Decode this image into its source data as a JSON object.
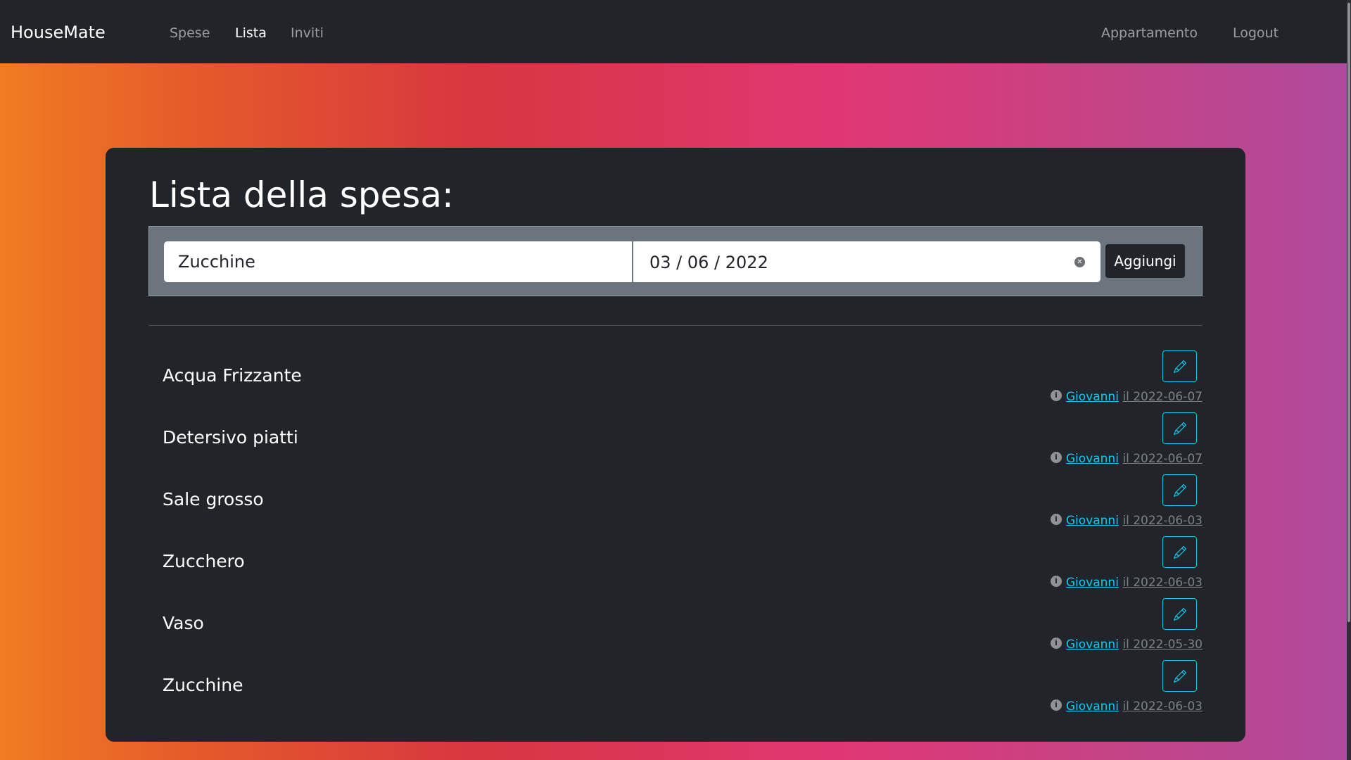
{
  "navbar": {
    "brand": "HouseMate",
    "left_links": [
      {
        "label": "Spese",
        "active": false
      },
      {
        "label": "Lista",
        "active": true
      },
      {
        "label": "Inviti",
        "active": false
      }
    ],
    "right_links": [
      {
        "label": "Appartamento"
      },
      {
        "label": "Logout"
      }
    ]
  },
  "page": {
    "title": "Lista della spesa:"
  },
  "form": {
    "item_value": "Zucchine",
    "date_value": "03 / 06 / 2022",
    "clear_icon": "x-circle-icon",
    "submit_label": "Aggiungi"
  },
  "items": [
    {
      "name": "Acqua Frizzante",
      "user": "Giovanni",
      "date_text": "il 2022-06-07"
    },
    {
      "name": "Detersivo piatti",
      "user": "Giovanni",
      "date_text": "il 2022-06-07"
    },
    {
      "name": "Sale grosso",
      "user": "Giovanni",
      "date_text": "il 2022-06-03"
    },
    {
      "name": "Zucchero",
      "user": "Giovanni",
      "date_text": "il 2022-06-03"
    },
    {
      "name": "Vaso",
      "user": "Giovanni",
      "date_text": "il 2022-05-30"
    },
    {
      "name": "Zucchine",
      "user": "Giovanni",
      "date_text": "il 2022-06-03"
    }
  ],
  "colors": {
    "navbar_bg": "#212529",
    "card_bg": "#212529",
    "form_bg": "#6c757d",
    "accent_info": "#0dcaf0"
  }
}
